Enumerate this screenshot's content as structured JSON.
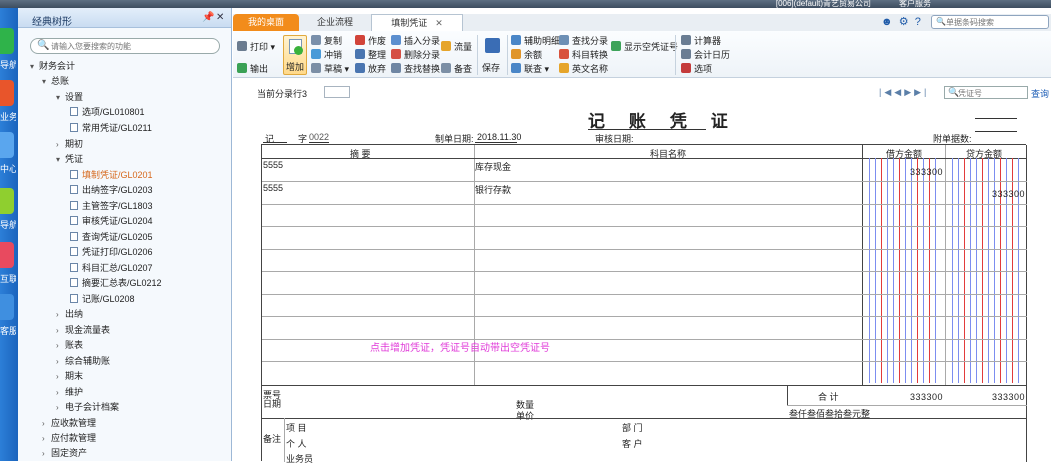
{
  "topbar": {
    "tenant": "[006](default)青艺贸易公司",
    "service": "客户服务"
  },
  "strip": {
    "items": [
      "导航",
      "业务",
      "中心",
      "导航",
      "互联",
      "客服"
    ]
  },
  "nav": {
    "title": "经典树形",
    "search_placeholder": "请输入您要搜索的功能",
    "tree": [
      "财务会计",
      "总账",
      "设置",
      "选项/GL010801",
      "常用凭证/GL0211",
      "期初",
      "凭证",
      "填制凭证/GL0201",
      "出纳签字/GL0203",
      "主管签字/GL1803",
      "审核凭证/GL0204",
      "查询凭证/GL0205",
      "凭证打印/GL0206",
      "科目汇总/GL0207",
      "摘要汇总表/GL0212",
      "记账/GL0208",
      "出纳",
      "现金流量表",
      "账表",
      "综合辅助账",
      "期末",
      "维护",
      "电子会计档案",
      "应收款管理",
      "应付款管理",
      "固定资产"
    ]
  },
  "tabs": [
    "我的桌面",
    "企业流程",
    "填制凭证"
  ],
  "help_search_placeholder": "单据条码搜索",
  "toolbar": {
    "print": "打印",
    "export": "输出",
    "add": "增加",
    "copy": "复制",
    "reverse": "冲销",
    "draft": "草稿",
    "void": "作废",
    "tidy": "整理",
    "abandon": "放弃",
    "insert_entry": "插入分录",
    "delete_entry": "删除分录",
    "find_replace": "查找替换",
    "flow": "流量",
    "memo": "备查",
    "save": "保存",
    "aux": "辅助明细",
    "balance": "余额",
    "link": "联查",
    "find_entry": "查找分录",
    "acct_convert": "科目转换",
    "english_name": "英文名称",
    "show_blank_no": "显示空凭证号",
    "calculator": "计算器",
    "calendar": "会计日历",
    "options": "选项"
  },
  "voucher": {
    "row_label": "当前分录行3",
    "search_placeholder": "凭证号",
    "search_btn": "查询",
    "title": "记 账 凭 证",
    "type": "记",
    "no_label": "字",
    "no": "0022",
    "date_label": "制单日期:",
    "date": "2018.11.30",
    "audit_label": "审核日期:",
    "attach_label": "附单据数:",
    "head_summary": "摘 要",
    "head_subject": "科目名称",
    "head_debit": "借方金额",
    "head_credit": "贷方金额",
    "rows": [
      {
        "summary": "5555",
        "subject": "库存现金",
        "debit": "333300",
        "credit": ""
      },
      {
        "summary": "5555",
        "subject": "银行存款",
        "debit": "",
        "credit": "333300"
      }
    ],
    "hint": "点击增加凭证，凭证号自动带出空凭证号",
    "bill_no": "票号",
    "bill_date": "日期",
    "qty": "数量",
    "unit": "单价",
    "total_label": "合 计",
    "total_debit": "333300",
    "total_credit": "333300",
    "total_words": "叁仟叁佰叁拾叁元整",
    "remark": "备注",
    "project": "项 目",
    "dept": "部 门",
    "person": "个 人",
    "customer": "客 户",
    "clerk": "业务员"
  }
}
